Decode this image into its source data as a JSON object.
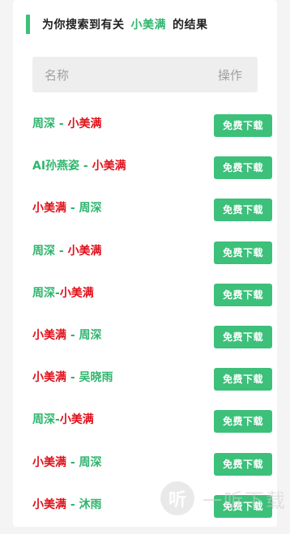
{
  "heading": {
    "prefix": "为你搜索到有关",
    "keyword": "小美满",
    "suffix": "的结果"
  },
  "table": {
    "col_name": "名称",
    "col_action": "操作"
  },
  "rows": [
    {
      "parts": [
        {
          "text": "周深 - ",
          "color": "green"
        },
        {
          "text": "小美满",
          "color": "red"
        }
      ],
      "button": "免费下载"
    },
    {
      "parts": [
        {
          "text": "AI孙燕姿 - ",
          "color": "green"
        },
        {
          "text": "小美满",
          "color": "red"
        }
      ],
      "button": "免费下载"
    },
    {
      "parts": [
        {
          "text": "小美满",
          "color": "red"
        },
        {
          "text": " - 周深",
          "color": "green"
        }
      ],
      "button": "免费下载"
    },
    {
      "parts": [
        {
          "text": "周深 - ",
          "color": "green"
        },
        {
          "text": "小美满",
          "color": "red"
        }
      ],
      "button": "免费下载"
    },
    {
      "parts": [
        {
          "text": "周深-",
          "color": "green"
        },
        {
          "text": "小美满",
          "color": "red"
        }
      ],
      "button": "免费下载"
    },
    {
      "parts": [
        {
          "text": "小美满",
          "color": "red"
        },
        {
          "text": " - 周深",
          "color": "green"
        }
      ],
      "button": "免费下载"
    },
    {
      "parts": [
        {
          "text": "小美满",
          "color": "red"
        },
        {
          "text": " - 吴晓雨",
          "color": "green"
        }
      ],
      "button": "免费下载"
    },
    {
      "parts": [
        {
          "text": "周深-",
          "color": "green"
        },
        {
          "text": "小美满",
          "color": "red"
        }
      ],
      "button": "免费下载"
    },
    {
      "parts": [
        {
          "text": "小美满",
          "color": "red"
        },
        {
          "text": " - 周深",
          "color": "green"
        }
      ],
      "button": "免费下载"
    },
    {
      "parts": [
        {
          "text": "小美满",
          "color": "red"
        },
        {
          "text": " - 沐雨",
          "color": "green"
        }
      ],
      "button": "免费下载"
    }
  ],
  "watermark": {
    "logo_char": "听",
    "text": "一听下载"
  },
  "colors": {
    "accent_green": "#3cc07a",
    "highlight_red": "#e0101a"
  }
}
